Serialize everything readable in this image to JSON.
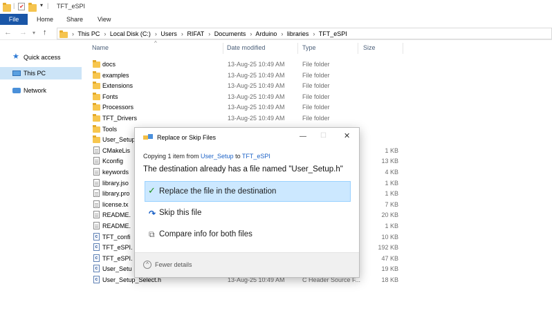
{
  "window": {
    "title": "TFT_eSPI"
  },
  "ribbon": {
    "tabs": [
      "File",
      "Home",
      "Share",
      "View"
    ]
  },
  "address": {
    "crumbs": [
      "This PC",
      "Local Disk (C:)",
      "Users",
      "RIFAT",
      "Documents",
      "Arduino",
      "libraries",
      "TFT_eSPI"
    ]
  },
  "sidebar": {
    "items": [
      {
        "label": "Quick access",
        "icon": "star-icon"
      },
      {
        "label": "This PC",
        "icon": "computer-icon"
      },
      {
        "label": "Network",
        "icon": "network-icon"
      }
    ]
  },
  "columns": {
    "name": "Name",
    "date": "Date modified",
    "type": "Type",
    "size": "Size"
  },
  "files": [
    {
      "name": "docs",
      "date": "13-Aug-25 10:49 AM",
      "type": "File folder",
      "size": "",
      "icon": "folder-icon"
    },
    {
      "name": "examples",
      "date": "13-Aug-25 10:49 AM",
      "type": "File folder",
      "size": "",
      "icon": "folder-icon"
    },
    {
      "name": "Extensions",
      "date": "13-Aug-25 10:49 AM",
      "type": "File folder",
      "size": "",
      "icon": "folder-icon"
    },
    {
      "name": "Fonts",
      "date": "13-Aug-25 10:49 AM",
      "type": "File folder",
      "size": "",
      "icon": "folder-icon"
    },
    {
      "name": "Processors",
      "date": "13-Aug-25 10:49 AM",
      "type": "File folder",
      "size": "",
      "icon": "folder-icon"
    },
    {
      "name": "TFT_Drivers",
      "date": "13-Aug-25 10:49 AM",
      "type": "File folder",
      "size": "",
      "icon": "folder-icon"
    },
    {
      "name": "Tools",
      "date": "",
      "type": "",
      "size": "",
      "icon": "folder-icon"
    },
    {
      "name": "User_Setup",
      "date": "",
      "type": "",
      "size": "",
      "icon": "folder-icon"
    },
    {
      "name": "CMakeLis",
      "date": "",
      "type": "",
      "size": "1 KB",
      "icon": "document-icon"
    },
    {
      "name": "Kconfig",
      "date": "",
      "type": "",
      "size": "13 KB",
      "icon": "document-icon"
    },
    {
      "name": "keywords",
      "date": "",
      "type": "",
      "size": "4 KB",
      "icon": "document-icon"
    },
    {
      "name": "library.jso",
      "date": "",
      "type": "",
      "size": "1 KB",
      "icon": "document-icon"
    },
    {
      "name": "library.pro",
      "date": "",
      "type": "",
      "size": "1 KB",
      "icon": "document-icon"
    },
    {
      "name": "license.tx",
      "date": "",
      "type": "",
      "size": "7 KB",
      "icon": "document-icon"
    },
    {
      "name": "README.",
      "date": "",
      "type": "",
      "size": "20 KB",
      "icon": "document-icon"
    },
    {
      "name": "README.",
      "date": "",
      "type": "",
      "size": "1 KB",
      "icon": "document-icon"
    },
    {
      "name": "TFT_confi",
      "date": "",
      "type": "",
      "size": "10 KB",
      "icon": "c-file-icon"
    },
    {
      "name": "TFT_eSPI.",
      "date": "",
      "type": "",
      "size": "192 KB",
      "icon": "c-file-icon"
    },
    {
      "name": "TFT_eSPI.",
      "date": "",
      "type": "",
      "size": "47 KB",
      "icon": "c-file-icon"
    },
    {
      "name": "User_Setu",
      "date": "",
      "type": "",
      "size": "19 KB",
      "icon": "c-file-icon"
    },
    {
      "name": "User_Setup_Select.h",
      "date": "13-Aug-25 10:49 AM",
      "type": "C Header Source F...",
      "size": "18 KB",
      "icon": "c-file-icon"
    }
  ],
  "dialog": {
    "title": "Replace or Skip Files",
    "copy_prefix": "Copying 1 item from ",
    "copy_from": "User_Setup",
    "copy_mid": " to ",
    "copy_to": "TFT_eSPI",
    "dest_message": "The destination already has a file named \"User_Setup.h\"",
    "options": {
      "replace": "Replace the file in the destination",
      "skip": "Skip this file",
      "compare": "Compare info for both files"
    },
    "fewer_details": "Fewer details",
    "controls": {
      "minimize": "—",
      "maximize": "☐",
      "close": "✕"
    }
  },
  "colors": {
    "accent": "#1a56a7",
    "highlight": "#c4121b",
    "selected": "#cce8ff"
  }
}
